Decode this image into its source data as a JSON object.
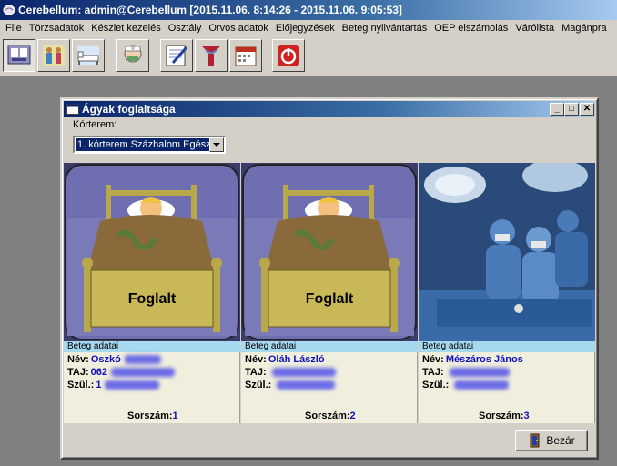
{
  "app": {
    "title": "Cerebellum: admin@Cerebellum [2015.11.06. 8:14:26 - 2015.11.06. 9:05:53]"
  },
  "menu": [
    "File",
    "Törzsadatok",
    "Készlet kezelés",
    "Osztály",
    "Orvos adatok",
    "Előjegyzések",
    "Beteg nyilvántartás",
    "OEP elszámolás",
    "Várólista",
    "Magánpra"
  ],
  "toolbar": {
    "icons": [
      "monitor-icon",
      "patients-icon",
      "bed-icon",
      "doctor-icon",
      "notepad-icon",
      "pharmacy-icon",
      "calendar-icon",
      "power-icon"
    ]
  },
  "window": {
    "title": "Ágyak foglaltsága",
    "room_label": "Kórterem:",
    "room_value": "1. kórterem Százhalom Egészs",
    "close_label": "Bezár"
  },
  "beds": [
    {
      "status": "Foglalt",
      "info_header": "Beteg adatai",
      "name_label": "Név:",
      "name_value": "Oszkó",
      "taj_label": "TAJ:",
      "taj_value": "062",
      "szul_label": "Szül.:",
      "szul_value": "1",
      "sorszam_label": "Sorszám:",
      "sorszam_value": "1"
    },
    {
      "status": "Foglalt",
      "info_header": "Beteg adatai",
      "name_label": "Név:",
      "name_value": "Oláh László",
      "taj_label": "TAJ:",
      "taj_value": "",
      "szul_label": "Szül.:",
      "szul_value": "",
      "sorszam_label": "Sorszám:",
      "sorszam_value": "2"
    },
    {
      "status": "",
      "info_header": "Beteg adatai",
      "name_label": "Név:",
      "name_value": "Mészáros  János",
      "taj_label": "TAJ:",
      "taj_value": "",
      "szul_label": "Szül.:",
      "szul_value": "",
      "sorszam_label": "Sorszám:",
      "sorszam_value": "3"
    }
  ],
  "colors": {
    "title_bar": "#0a246a",
    "window_face": "#d4d0c8",
    "info_header_bg": "#a6d8f0",
    "value_blue": "#1010c0",
    "bed_frame": "#b8a84a",
    "blanket": "#8a6a3a",
    "surgery_blue": "#3a6aa8"
  }
}
